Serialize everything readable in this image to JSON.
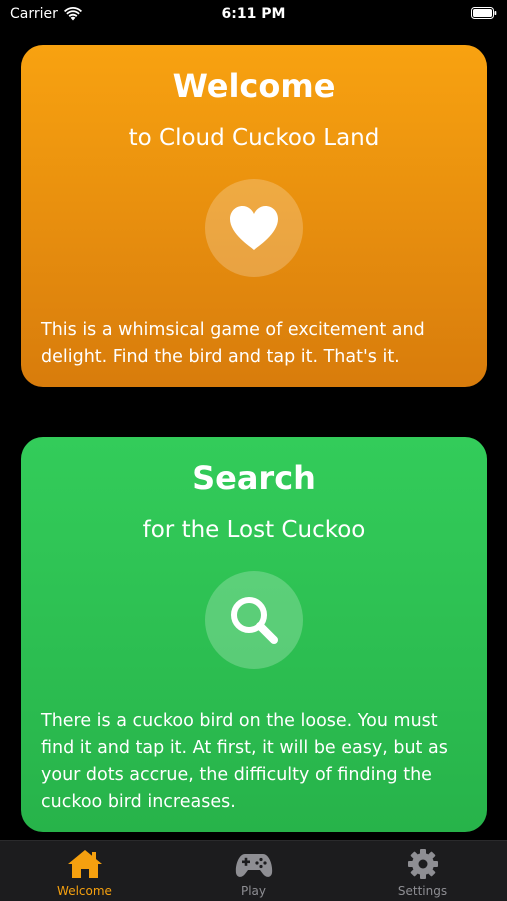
{
  "status_bar": {
    "carrier": "Carrier",
    "time": "6:11 PM",
    "wifi_icon": "wifi-icon",
    "battery_icon": "battery-icon"
  },
  "cards": {
    "welcome": {
      "title": "Welcome",
      "subtitle": "to Cloud Cuckoo Land",
      "icon": "heart-icon",
      "body": "This is a whimsical game of excitement and delight. Find the bird and tap it. That's it.",
      "color": "#f49a0f"
    },
    "search": {
      "title": "Search",
      "subtitle": "for the Lost Cuckoo",
      "icon": "magnifying-glass-icon",
      "body": "There is a cuckoo bird on the loose. You must find it and tap it. At first, it will be easy, but as your dots accrue, the difficulty of finding the cuckoo bird increases.",
      "color": "#2fc454"
    }
  },
  "tab_bar": {
    "tabs": [
      {
        "label": "Welcome",
        "icon": "house-icon",
        "active": true
      },
      {
        "label": "Play",
        "icon": "gamecontroller-icon",
        "active": false
      },
      {
        "label": "Settings",
        "icon": "gear-icon",
        "active": false
      }
    ],
    "active_color": "#f5a00f",
    "inactive_color": "#8e8e93"
  }
}
